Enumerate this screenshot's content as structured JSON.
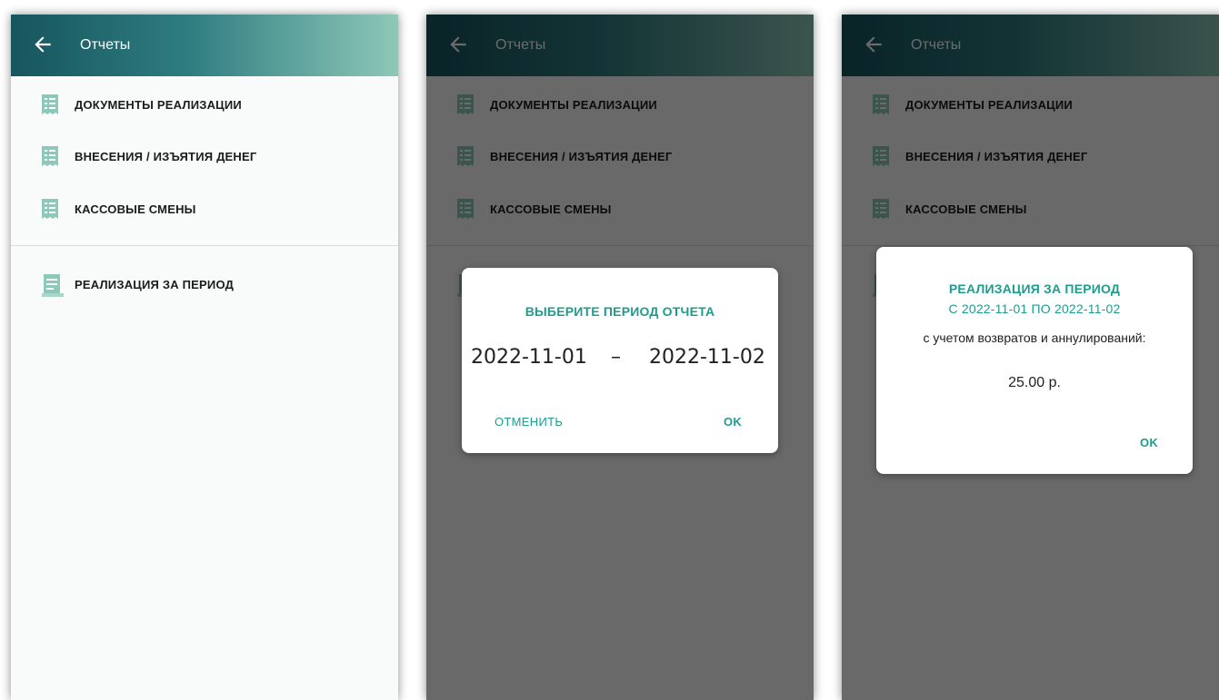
{
  "header": {
    "title": "Отчеты"
  },
  "menu": {
    "items": [
      {
        "label": "ДОКУМЕНТЫ РЕАЛИЗАЦИИ",
        "icon": "receipt-icon"
      },
      {
        "label": "ВНЕСЕНИЯ / ИЗЪЯТИЯ ДЕНЕГ",
        "icon": "receipt-icon"
      },
      {
        "label": "КАССОВЫЕ СМЕНЫ",
        "icon": "receipt-icon"
      },
      {
        "label": "РЕАЛИЗАЦИЯ ЗА ПЕРИОД",
        "icon": "report-icon"
      }
    ]
  },
  "period_dialog": {
    "title": "ВЫБЕРИТЕ ПЕРИОД ОТЧЕТА",
    "date_from": "2022-11-01",
    "separator": "–",
    "date_to": "2022-11-02",
    "cancel_label": "ОТМЕНИТЬ",
    "ok_label": "OK"
  },
  "result_dialog": {
    "title_line1": "РЕАЛИЗАЦИЯ ЗА ПЕРИОД",
    "title_line2": "С 2022-11-01 ПО 2022-11-02",
    "subtitle": "с учетом возвратов и аннулирований:",
    "amount": "25.00 р.",
    "ok_label": "OK"
  },
  "colors": {
    "accent": "#1e9c8e",
    "icon": "#8ec8b8",
    "appbar_start": "#17555e",
    "appbar_end": "#8ec8b8"
  }
}
